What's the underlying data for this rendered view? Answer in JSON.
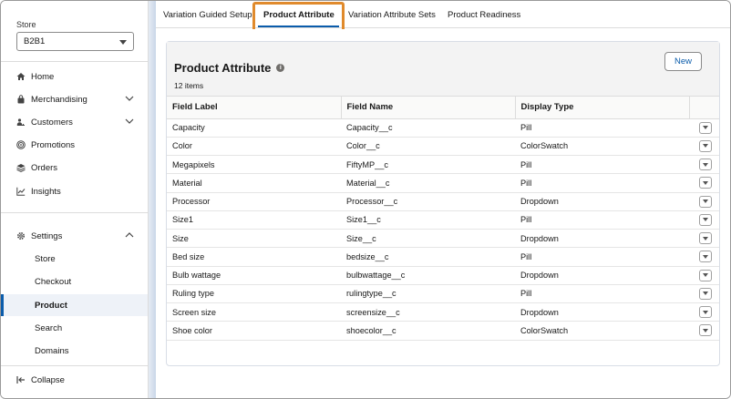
{
  "sidebar": {
    "store_label": "Store",
    "store_value": "B2B1",
    "nav": {
      "home": "Home",
      "merchandising": "Merchandising",
      "customers": "Customers",
      "promotions": "Promotions",
      "orders": "Orders",
      "insights": "Insights",
      "settings": "Settings",
      "collapse": "Collapse"
    },
    "settings_items": [
      "Store",
      "Checkout",
      "Product",
      "Search",
      "Domains"
    ]
  },
  "tabs": [
    "Variation Guided Setup",
    "Product Attribute",
    "Variation Attribute Sets",
    "Product Readiness"
  ],
  "card": {
    "title": "Product Attribute",
    "count": "12 items",
    "new_label": "New",
    "columns": [
      "Field Label",
      "Field Name",
      "Display Type"
    ],
    "rows": [
      [
        "Capacity",
        "Capacity__c",
        "Pill"
      ],
      [
        "Color",
        "Color__c",
        "ColorSwatch"
      ],
      [
        "Megapixels",
        "FiftyMP__c",
        "Pill"
      ],
      [
        "Material",
        "Material__c",
        "Pill"
      ],
      [
        "Processor",
        "Processor__c",
        "Dropdown"
      ],
      [
        "Size1",
        "Size1__c",
        "Pill"
      ],
      [
        "Size",
        "Size__c",
        "Dropdown"
      ],
      [
        "Bed size",
        "bedsize__c",
        "Pill"
      ],
      [
        "Bulb wattage",
        "bulbwattage__c",
        "Dropdown"
      ],
      [
        "Ruling type",
        "rulingtype__c",
        "Pill"
      ],
      [
        "Screen size",
        "screensize__c",
        "Dropdown"
      ],
      [
        "Shoe color",
        "shoecolor__c",
        "ColorSwatch"
      ]
    ]
  },
  "colors": {
    "accent": "#0b5cab",
    "highlight": "#e08a2c"
  }
}
